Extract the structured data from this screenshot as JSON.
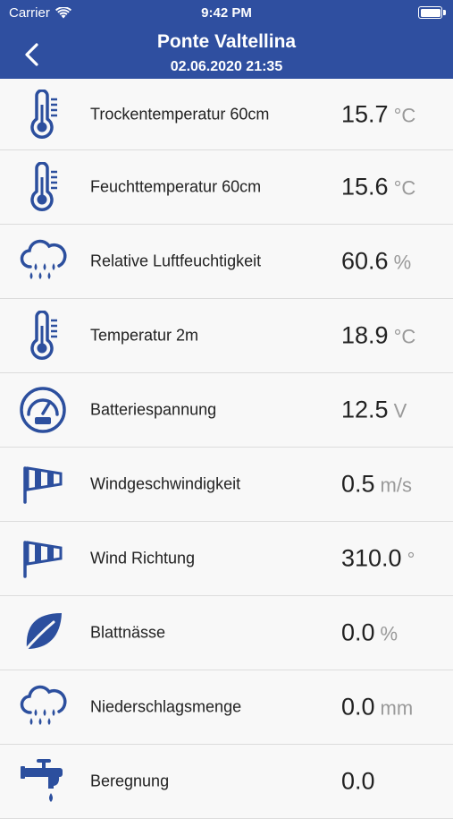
{
  "status_bar": {
    "carrier": "Carrier",
    "time": "9:42 PM"
  },
  "header": {
    "title": "Ponte Valtellina",
    "subtitle": "02.06.2020 21:35"
  },
  "colors": {
    "brand": "#2f4fa0",
    "icon": "#2c4f9e"
  },
  "rows": [
    {
      "icon": "thermometer-icon",
      "label": "Trockentemperatur 60cm",
      "value": "15.7",
      "unit": "°C"
    },
    {
      "icon": "thermometer-icon",
      "label": "Feuchttemperatur 60cm",
      "value": "15.6",
      "unit": "°C"
    },
    {
      "icon": "rain-cloud-icon",
      "label": "Relative Luftfeuchtigkeit",
      "value": "60.6",
      "unit": "%"
    },
    {
      "icon": "thermometer-icon",
      "label": "Temperatur 2m",
      "value": "18.9",
      "unit": "°C"
    },
    {
      "icon": "gauge-icon",
      "label": "Batteriespannung",
      "value": "12.5",
      "unit": "V"
    },
    {
      "icon": "windsock-icon",
      "label": "Windgeschwindigkeit",
      "value": "0.5",
      "unit": "m/s"
    },
    {
      "icon": "windsock-icon",
      "label": "Wind Richtung",
      "value": "310.0",
      "unit": "°"
    },
    {
      "icon": "leaf-icon",
      "label": "Blattnässe",
      "value": "0.0",
      "unit": "%"
    },
    {
      "icon": "rain-cloud-icon",
      "label": "Niederschlagsmenge",
      "value": "0.0",
      "unit": "mm"
    },
    {
      "icon": "faucet-icon",
      "label": "Beregnung",
      "value": "0.0",
      "unit": ""
    }
  ]
}
